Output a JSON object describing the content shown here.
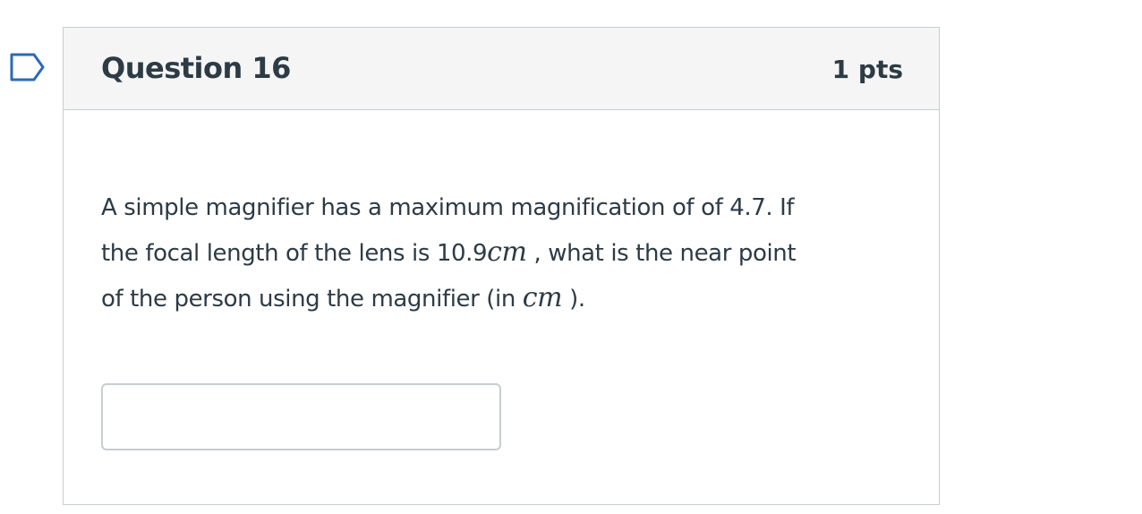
{
  "question": {
    "title": "Question 16",
    "points": "1 pts",
    "text_line1": "A simple magnifier has a maximum  magnification of   of 4.7.   If",
    "text_line2_before": "the focal length of the lens is 10.9",
    "unit_cm": "cm",
    "text_line2_after": " ,  what is the near point",
    "text_line3_before": "of the person using the magnifier (in ",
    "text_line3_after": " ).",
    "answer_value": "",
    "answer_placeholder": ""
  },
  "icons": {
    "flag": "flag-question-icon"
  },
  "colors": {
    "text": "#2d3b45",
    "header_bg": "#f5f5f5",
    "border": "#c7cdd1",
    "flag_outline": "#2d6ab4"
  }
}
